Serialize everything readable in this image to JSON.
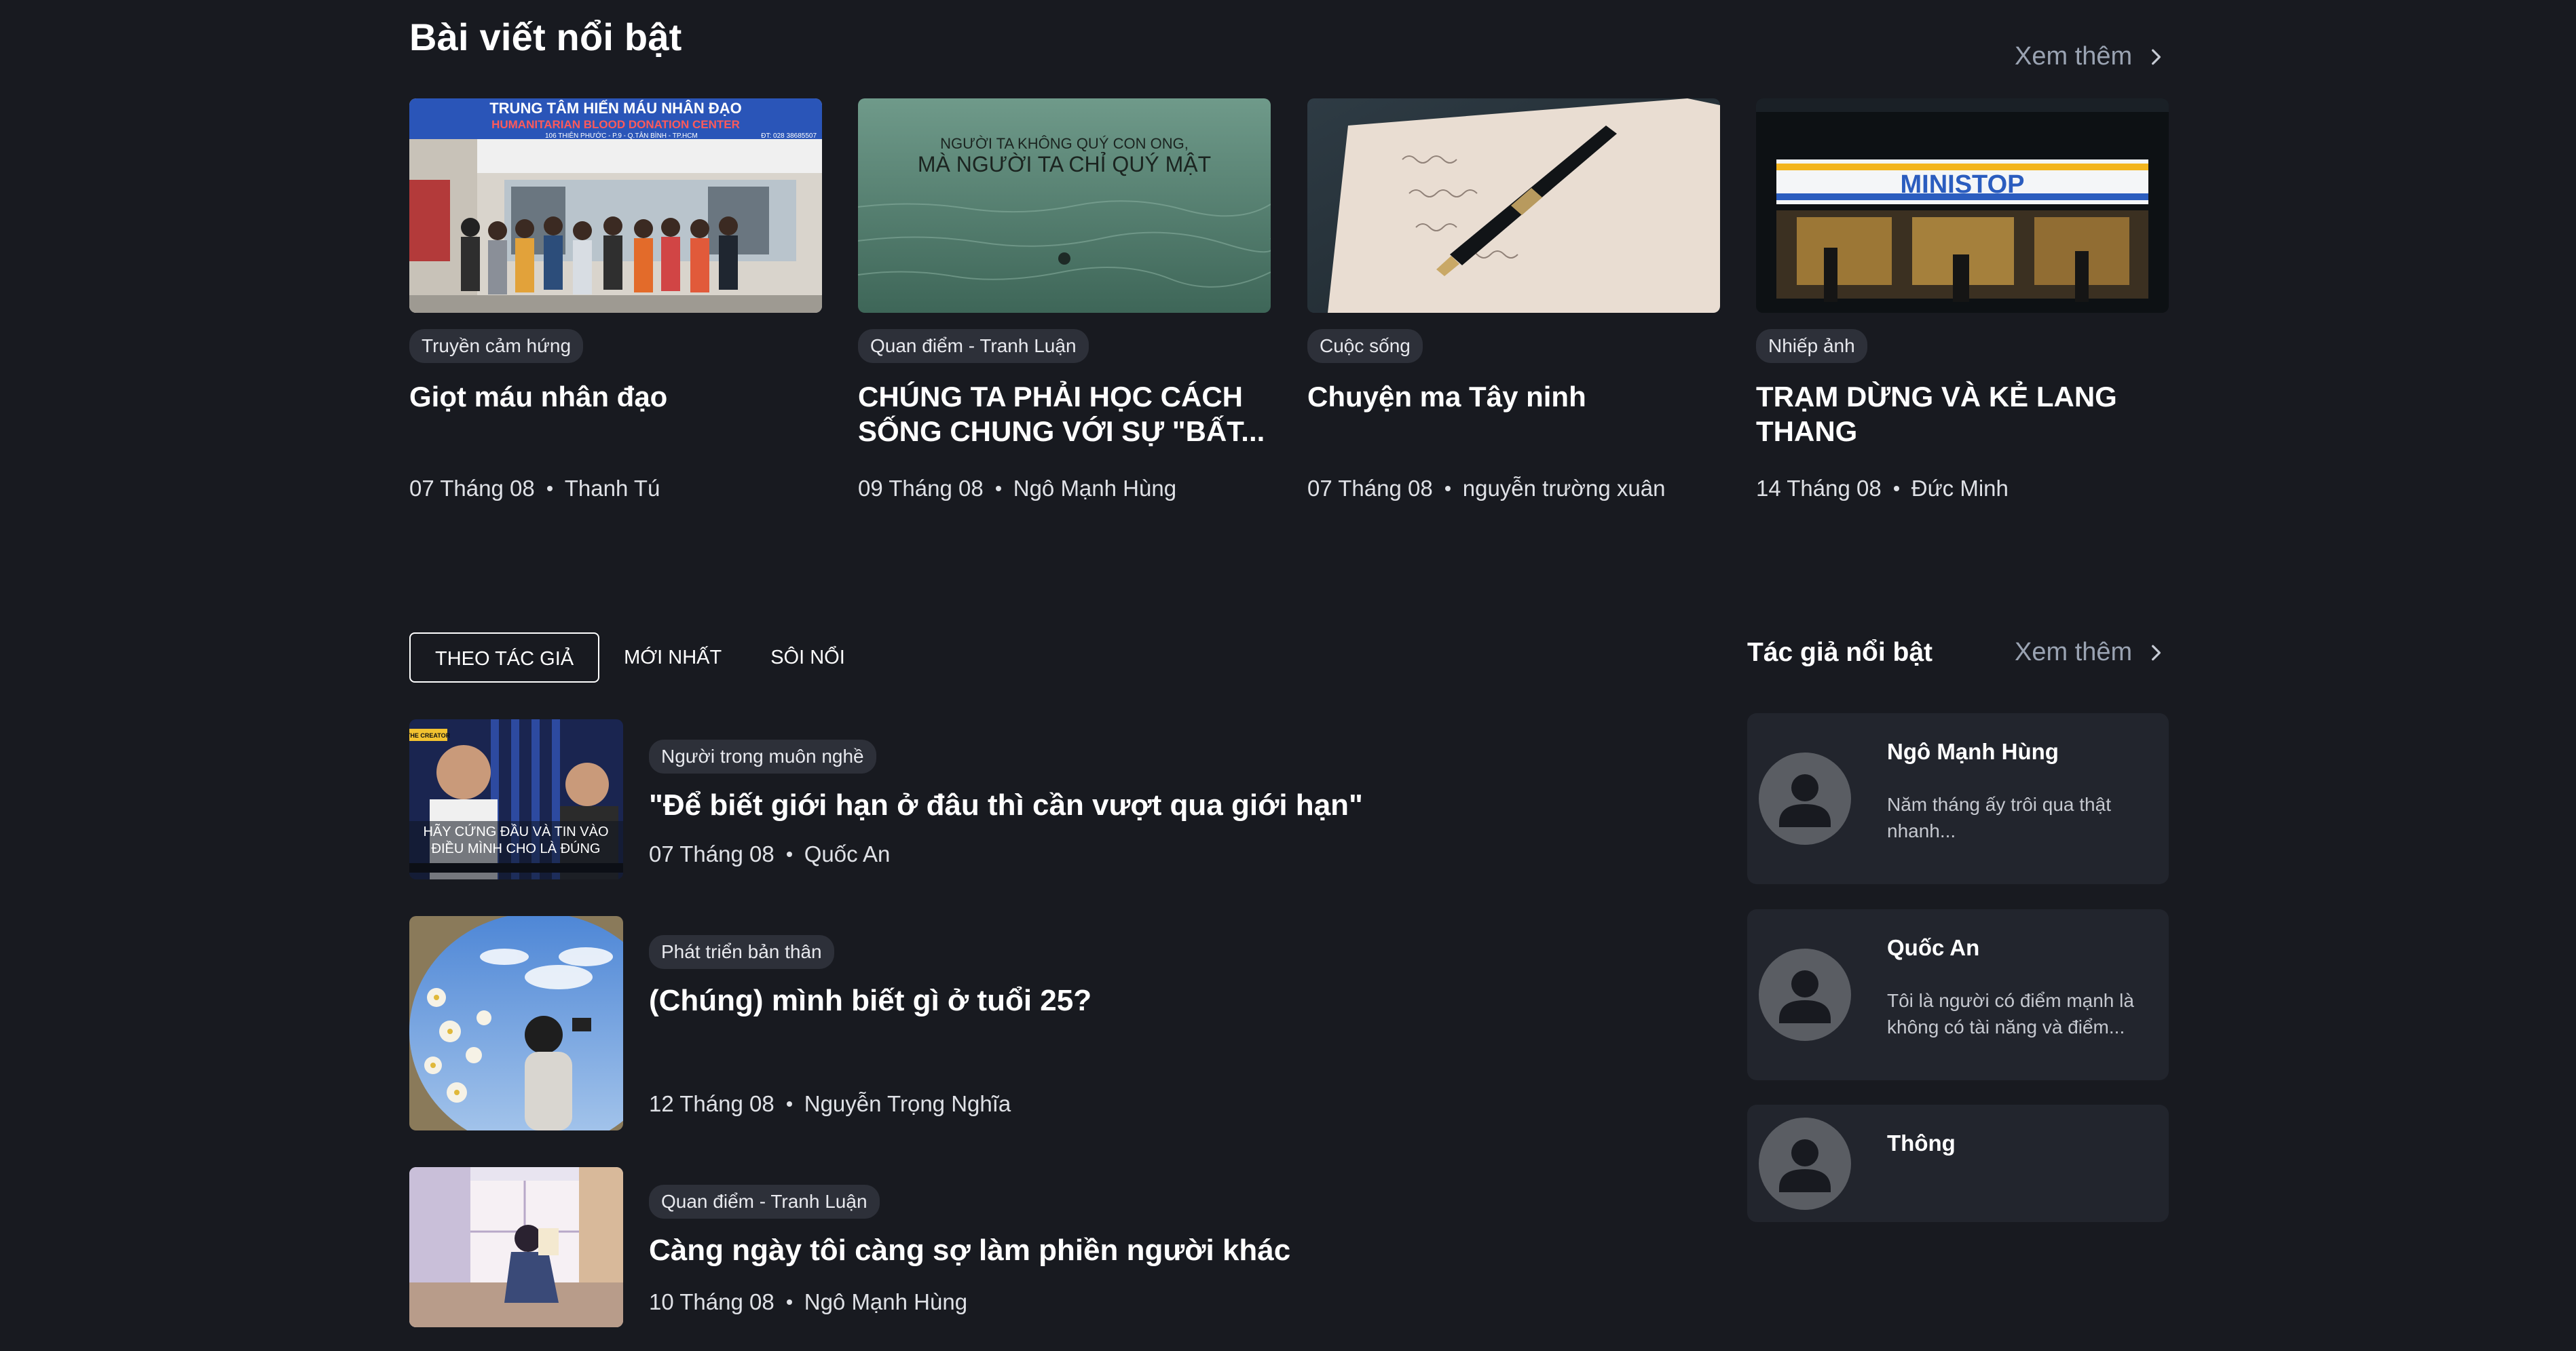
{
  "featured": {
    "title": "Bài viết nổi bật",
    "see_more": "Xem thêm",
    "cards": [
      {
        "category": "Truyền cảm hứng",
        "title": "Giọt máu nhân đạo",
        "date": "07 Tháng 08",
        "author": "Thanh Tú",
        "image_text": {
          "line1": "TRUNG TÂM HIẾN MÁU NHÂN ĐẠO",
          "line2": "HUMANITARIAN BLOOD DONATION CENTER",
          "line3": "106 THIÊN PHƯỚC - P.9 - Q.TÂN BÌNH - TP.HCM",
          "line4": "ĐT: 028 38685507"
        }
      },
      {
        "category": "Quan điểm - Tranh Luận",
        "title": "CHÚNG TA PHẢI HỌC CÁCH SỐNG CHUNG VỚI SỰ \"BẤT...",
        "date": "09 Tháng 08",
        "author": "Ngô Mạnh Hùng",
        "image_text": {
          "line1": "NGƯỜI TA KHÔNG QUÝ CON ONG,",
          "line2": "MÀ NGƯỜI TA CHỈ QUÝ MẬT"
        }
      },
      {
        "category": "Cuộc sống",
        "title": "Chuyện ma Tây ninh",
        "date": "07 Tháng 08",
        "author": "nguyễn trường xuân"
      },
      {
        "category": "Nhiếp ảnh",
        "title": "TRẠM DỪNG VÀ KẺ LANG THANG",
        "date": "14 Tháng 08",
        "author": "Đức Minh",
        "image_text": {
          "line1": "MINISTOP"
        }
      }
    ]
  },
  "tabs": [
    "THEO TÁC GIẢ",
    "MỚI NHẤT",
    "SÔI NỔI"
  ],
  "active_tab": "THEO TÁC GIẢ",
  "posts": [
    {
      "category": "Người trong muôn nghề",
      "title": "\"Để biết giới hạn ở đâu thì cần vượt qua giới hạn\"",
      "date": "07 Tháng 08",
      "author": "Quốc An",
      "image_text": {
        "line1": "HÃY CỨNG ĐẦU VÀ TIN VÀO",
        "line2": "ĐIỀU MÌNH CHO LÀ ĐÚNG",
        "badge": "THE CREATOR"
      }
    },
    {
      "category": "Phát triển bản thân",
      "title": "(Chúng) mình biết gì ở tuổi 25?",
      "date": "12 Tháng 08",
      "author": "Nguyễn Trọng Nghĩa"
    },
    {
      "category": "Quan điểm - Tranh Luận",
      "title": "Càng ngày tôi càng sợ làm phiền người khác",
      "date": "10 Tháng 08",
      "author": "Ngô Mạnh Hùng"
    }
  ],
  "authors": {
    "title": "Tác giả nổi bật",
    "see_more": "Xem thêm",
    "items": [
      {
        "name": "Ngô Mạnh Hùng",
        "bio": "Năm tháng ấy trôi qua thật nhanh..."
      },
      {
        "name": "Quốc An",
        "bio": "Tôi là người có điểm mạnh là không có tài năng và điểm..."
      },
      {
        "name": "Thông",
        "bio": ""
      }
    ]
  },
  "icons": {
    "see_more": "chevron-right-icon",
    "avatar": "user-silhouette-icon"
  },
  "colors": {
    "background": "#181a20",
    "card_background": "#22252d",
    "tag_background": "#2d3039",
    "muted_text": "#9aa3b2"
  }
}
